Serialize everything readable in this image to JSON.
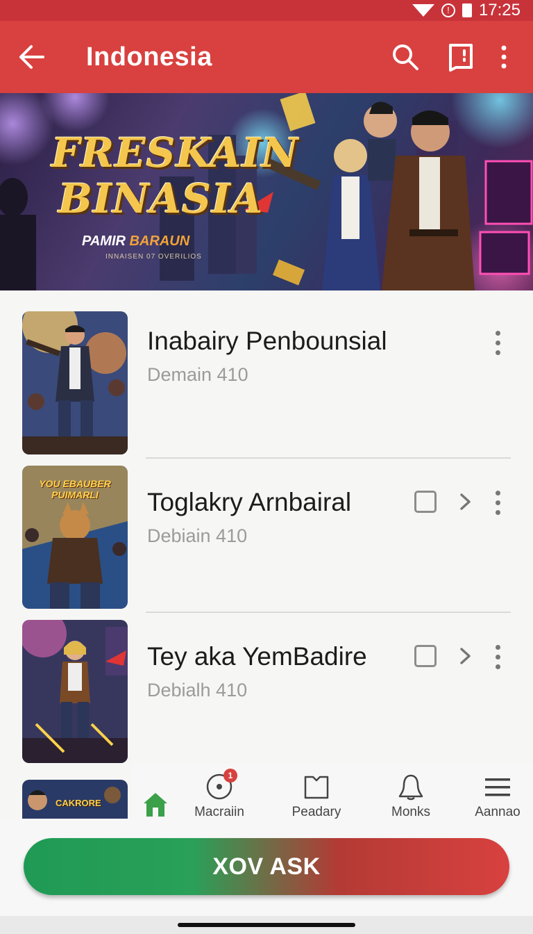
{
  "status_bar": {
    "time": "17:25",
    "icons": [
      "wifi-icon",
      "alarm-icon",
      "battery-icon"
    ]
  },
  "app_bar": {
    "title": "Indonesia",
    "actions": [
      "search-icon",
      "bookmark-icon",
      "more-vert-icon"
    ]
  },
  "hero": {
    "title_line1": "FRESKAIN",
    "title_line2": "BINASIA",
    "subtitle_a": "PAMIR",
    "subtitle_b": "BARAUN",
    "small_text": "INNAISEN 07 OVERILIOS"
  },
  "list": {
    "items": [
      {
        "title": "Inabairy Penbounsial",
        "subtitle": "Demain 410",
        "thumb_caption": ""
      },
      {
        "title": "Toglakry Arnbairal",
        "subtitle": "Debiain 410",
        "thumb_caption": "YOU EBAUBER PUIMARLI"
      },
      {
        "title": "Tey aka YemBadire",
        "subtitle": "Debialh 410",
        "thumb_caption": ""
      },
      {
        "title": "",
        "subtitle": "",
        "thumb_caption": "CAKRORE"
      }
    ]
  },
  "bottom_nav": {
    "items": [
      {
        "label": "",
        "icon": "home-icon"
      },
      {
        "label": "Macraiin",
        "icon": "target-icon",
        "badge": "1"
      },
      {
        "label": "Peadary",
        "icon": "book-icon"
      },
      {
        "label": "Monks",
        "icon": "bell-icon"
      },
      {
        "label": "Aannao",
        "icon": "menu-icon"
      }
    ]
  },
  "cta": {
    "label": "XOV ASK"
  },
  "colors": {
    "primary_red": "#d8413f",
    "green": "#1f9a55",
    "home_green": "#3aa04a"
  }
}
